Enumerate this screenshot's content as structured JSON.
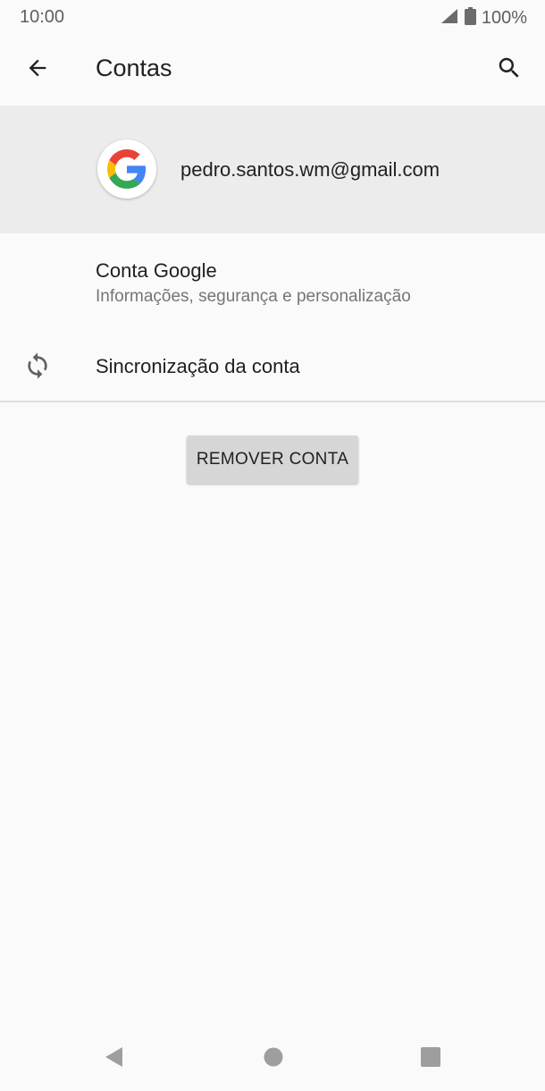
{
  "status_bar": {
    "time": "10:00",
    "battery": "100%",
    "signal_icon": "signal-icon",
    "battery_icon": "battery-icon"
  },
  "app_bar": {
    "title": "Contas",
    "back_icon": "arrow-back-icon",
    "search_icon": "search-icon"
  },
  "account": {
    "email": "pedro.santos.wm@gmail.com",
    "logo_icon": "google-logo-icon"
  },
  "items": [
    {
      "title": "Conta Google",
      "subtitle": "Informações, segurança e personalização"
    },
    {
      "title": "Sincronização da conta",
      "icon": "sync-icon"
    }
  ],
  "remove_button": {
    "label": "REMOVER CONTA"
  },
  "nav_bar": {
    "back_icon": "nav-back-icon",
    "home_icon": "nav-home-icon",
    "recents_icon": "nav-recents-icon"
  }
}
